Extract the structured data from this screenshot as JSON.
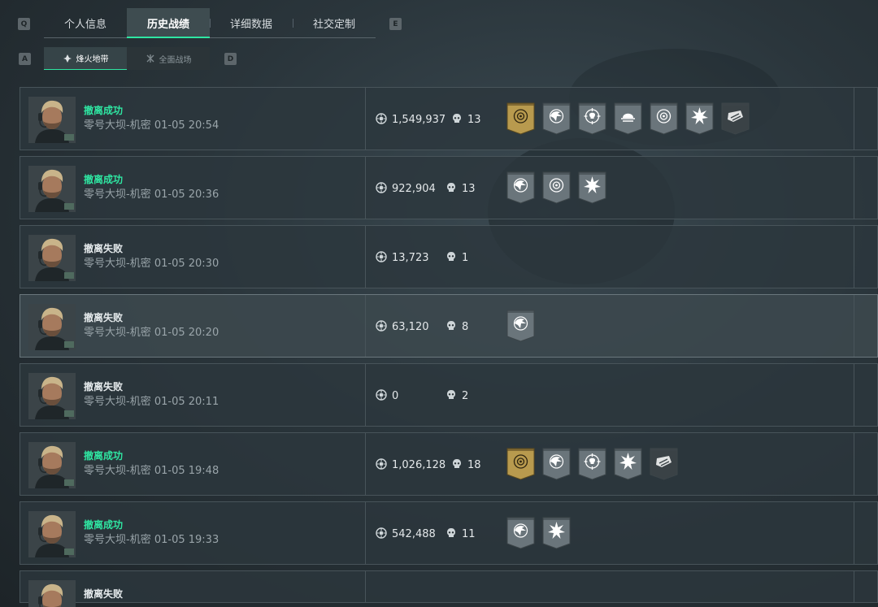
{
  "key_hints": {
    "left_tab": "Q",
    "right_tab": "E",
    "left_sub": "A",
    "right_sub": "D"
  },
  "top_tabs": [
    {
      "label": "个人信息",
      "active": false
    },
    {
      "label": "历史战绩",
      "active": true
    },
    {
      "label": "详细数据",
      "active": false
    },
    {
      "label": "社交定制",
      "active": false
    }
  ],
  "sub_tabs": [
    {
      "label": "烽火地带",
      "icon": "tower-icon",
      "active": true
    },
    {
      "label": "全面战场",
      "icon": "crossed-arrows-icon",
      "active": false
    }
  ],
  "colors": {
    "accent": "#2fe6a2",
    "success": "#2fe6a2",
    "gold_badge": "#b89a4e",
    "grey_badge": "#6a757b"
  },
  "matches": [
    {
      "result": "撤离成功",
      "success": true,
      "map": "零号大坝-机密",
      "time": "01-05 20:54",
      "value": "1,549,937",
      "kills": "13",
      "badges": [
        "gold-target-badge",
        "eagle-badge",
        "crosshair-skull-badge",
        "sunrise-badge",
        "target-badge",
        "starburst-badge",
        "stripe-badge"
      ]
    },
    {
      "result": "撤离成功",
      "success": true,
      "map": "零号大坝-机密",
      "time": "01-05 20:36",
      "value": "922,904",
      "kills": "13",
      "badges": [
        "eagle-badge",
        "target-badge",
        "starburst-badge"
      ]
    },
    {
      "result": "撤离失败",
      "success": false,
      "map": "零号大坝-机密",
      "time": "01-05 20:30",
      "value": "13,723",
      "kills": "1",
      "badges": []
    },
    {
      "result": "撤离失败",
      "success": false,
      "map": "零号大坝-机密",
      "time": "01-05 20:20",
      "value": "63,120",
      "kills": "8",
      "badges": [
        "eagle-badge"
      ]
    },
    {
      "result": "撤离失败",
      "success": false,
      "map": "零号大坝-机密",
      "time": "01-05 20:11",
      "value": "0",
      "kills": "2",
      "badges": []
    },
    {
      "result": "撤离成功",
      "success": true,
      "map": "零号大坝-机密",
      "time": "01-05 19:48",
      "value": "1,026,128",
      "kills": "18",
      "badges": [
        "gold-target-badge",
        "eagle-badge",
        "crosshair-skull-badge",
        "starburst-badge",
        "stripe-badge"
      ]
    },
    {
      "result": "撤离成功",
      "success": true,
      "map": "零号大坝-机密",
      "time": "01-05 19:33",
      "value": "542,488",
      "kills": "11",
      "badges": [
        "eagle-badge",
        "starburst-badge"
      ]
    },
    {
      "result": "撤离失败",
      "success": false,
      "map": "",
      "time": "",
      "value": "",
      "kills": "",
      "badges": []
    }
  ]
}
